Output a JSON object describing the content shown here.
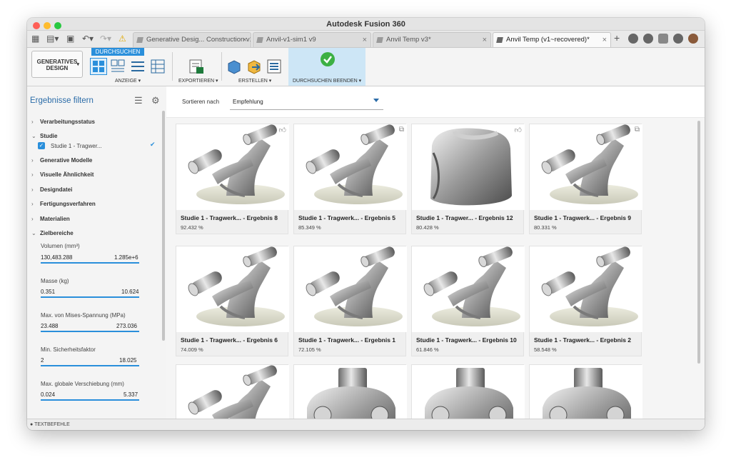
{
  "window": {
    "title": "Autodesk Fusion 360"
  },
  "tabs": [
    {
      "label": "Generative Desig... Construction v1",
      "active": false
    },
    {
      "label": "Anvil-v1-sim1 v9",
      "active": false
    },
    {
      "label": "Anvil Temp v3*",
      "active": false
    },
    {
      "label": "Anvil Temp (v1~recovered)*",
      "active": true
    }
  ],
  "toolbar": {
    "warning_icon": "⚠"
  },
  "ribbon": {
    "workspace_label": "GENERATIVES DESIGN",
    "active_tab": "DURCHSUCHEN",
    "groups": {
      "anzeige": "ANZEIGE ▾",
      "exportieren": "EXPORTIEREN ▾",
      "erstellen": "ERSTELLEN ▾",
      "beenden": "DURCHSUCHEN BEENDEN ▾"
    }
  },
  "sidebar": {
    "title": "Ergebnisse filtern",
    "categories": {
      "verarbeitungsstatus": "Verarbeitungsstatus",
      "studie": "Studie",
      "studie_item": "Studie 1 - Tragwer...",
      "generative_modelle": "Generative Modelle",
      "visuelle_aehnlichkeit": "Visuelle Ähnlichkeit",
      "designdatei": "Designdatei",
      "fertigungsverfahren": "Fertigungsverfahren",
      "materialien": "Materialien",
      "zielbereiche": "Zielbereiche"
    },
    "ranges": [
      {
        "label": "Volumen (mm³)",
        "min": "130,483.288",
        "max": "1.285e+6"
      },
      {
        "label": "Masse (kg)",
        "min": "0.351",
        "max": "10.624"
      },
      {
        "label": "Max. von Mises-Spannung (MPa)",
        "min": "23.488",
        "max": "273.036"
      },
      {
        "label": "Min. Sicherheitsfaktor",
        "min": "2",
        "max": "18.025"
      },
      {
        "label": "Max. globale Verschiebung (mm)",
        "min": "0.024",
        "max": "5.337"
      }
    ]
  },
  "sort": {
    "label": "Sortieren nach",
    "value": "Empfehlung"
  },
  "results": [
    {
      "name": "Studie 1 - Tragwerk... - Ergebnis 8",
      "score": "92.432 %"
    },
    {
      "name": "Studie 1 - Tragwerk... - Ergebnis 5",
      "score": "85.349 %"
    },
    {
      "name": "Studie 1 - Tragwer... - Ergebnis 12",
      "score": "80.428 %"
    },
    {
      "name": "Studie 1 - Tragwerk... - Ergebnis 9",
      "score": "80.331 %"
    },
    {
      "name": "Studie 1 - Tragwerk... - Ergebnis 6",
      "score": "74.009 %"
    },
    {
      "name": "Studie 1 - Tragwerk... - Ergebnis 1",
      "score": "72.105 %"
    },
    {
      "name": "Studie 1 - Tragwerk... - Ergebnis 10",
      "score": "61.846 %"
    },
    {
      "name": "Studie 1 - Tragwerk... - Ergebnis 2",
      "score": "58.548 %"
    }
  ],
  "statusbar": {
    "label": "TEXTBEFEHLE"
  },
  "colors": {
    "accent": "#2a8fdb",
    "title_blue": "#2b6ca8"
  }
}
